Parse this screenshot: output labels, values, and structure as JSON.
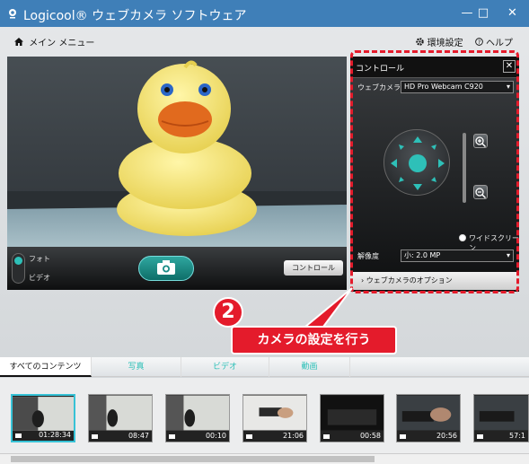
{
  "app": {
    "title": "Logicool® ウェブカメラ ソフトウェア",
    "window_controls": {
      "minimize": "—",
      "maximize": "□",
      "close": "✕"
    }
  },
  "topnav": {
    "menu_label": "メイン メニュー",
    "settings_label": "環境設定",
    "help_label": "ヘルプ",
    "icons": {
      "menu": "home-icon",
      "settings": "gear-icon",
      "help": "help-icon"
    }
  },
  "preview": {
    "photo_label": "フォト",
    "video_label": "ビデオ",
    "control_button": "コントロール",
    "icons": {
      "capture": "camera-icon"
    }
  },
  "control_panel": {
    "title": "コントロール",
    "webcam_label": "ウェブカメラ",
    "webcam_value": "HD Pro Webcam C920",
    "widescreen_label": "ワイドスクリーン",
    "resolution_label": "解像度",
    "resolution_value": "小: 2.0 MP",
    "options_label": "ウェブカメラのオプション",
    "icons": {
      "pan": "dpad-icon",
      "zoom_in": "zoom-in-icon",
      "zoom_out": "zoom-out-icon"
    }
  },
  "annotation": {
    "number": "2",
    "text": "カメラの設定を行う",
    "color": "#e41b2b"
  },
  "tabs": [
    "すべてのコンテンツ",
    "写真",
    "ビデオ",
    "動画"
  ],
  "thumbnails": [
    "01:28:34",
    "08:47",
    "00:10",
    "21:06",
    "00:58",
    "20:56",
    "57:1"
  ],
  "colors": {
    "titlebar": "#3f7fb8",
    "accent": "#2ec0b8"
  }
}
